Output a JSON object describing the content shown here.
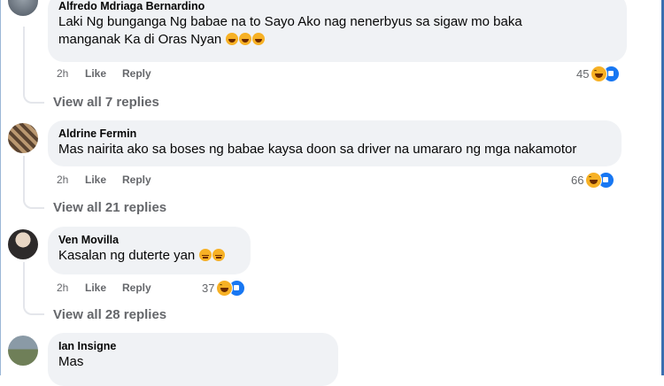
{
  "comments": [
    {
      "author": "Alfredo Mdriaga Bernardino",
      "lines": [
        "Laki Ng bunganga Ng babae na to Sayo Ako nag nenerbyus sa sigaw mo baka",
        "manganak Ka di Oras Nyan"
      ],
      "emoji_names": [
        "rolling-on-floor-laughing",
        "rolling-on-floor-laughing",
        "rolling-on-floor-laughing"
      ],
      "time": "2h",
      "like_label": "Like",
      "reply_label": "Reply",
      "reaction_count": "45",
      "view_replies": "View all 7 replies"
    },
    {
      "author": "Aldrine Fermin",
      "lines": [
        "Mas nairita ako sa boses ng babae kaysa doon sa driver na umararo ng mga nakamotor"
      ],
      "time": "2h",
      "like_label": "Like",
      "reply_label": "Reply",
      "reaction_count": "66",
      "view_replies": "View all 21 replies"
    },
    {
      "author": "Ven Movilla",
      "lines": [
        "Kasalan ng duterte yan"
      ],
      "emoji_names": [
        "pensive-face",
        "pensive-face"
      ],
      "time": "2h",
      "like_label": "Like",
      "reply_label": "Reply",
      "reaction_count": "37",
      "view_replies": "View all 28 replies"
    },
    {
      "author": "Ian Insigne",
      "lines": [
        "Mas"
      ]
    }
  ],
  "reaction_icons": [
    "haha-reaction-icon",
    "like-reaction-icon"
  ],
  "colors": {
    "bubble": "#f0f2f5",
    "secondary_text": "#65676b",
    "like_blue": "#1877f2",
    "haha_yellow": "#f7b125"
  }
}
